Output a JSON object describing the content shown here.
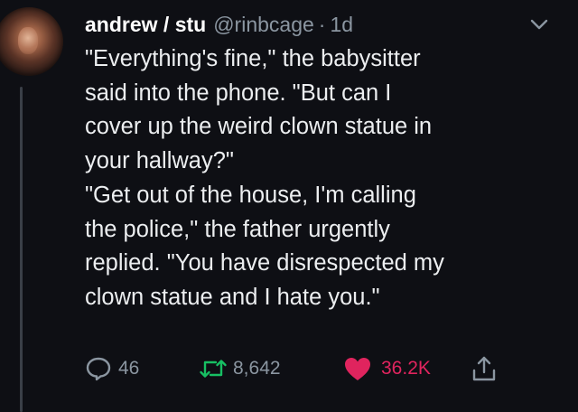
{
  "tweet": {
    "author_name": "andrew / stu",
    "handle": "@rinbcage",
    "separator": "·",
    "time": "1d",
    "lines": [
      "\"Everything's fine,\" the babysitter",
      "said into the phone. \"But can I",
      "cover up the weird clown statue in",
      "your hallway?\"",
      "\"Get out of the house, I'm calling",
      "the police,\" the father urgently",
      "replied. \"You have disrespected my",
      "clown statue and I hate you.\""
    ]
  },
  "actions": {
    "replies": "46",
    "retweets": "8,642",
    "likes": "36.2K"
  },
  "icons": {
    "reply": "reply-icon",
    "retweet": "retweet-icon",
    "like": "heart-icon",
    "share": "share-icon",
    "menu": "chevron-down-icon"
  },
  "colors": {
    "background": "#0e0f14",
    "text": "#eceef0",
    "secondary": "#8b96a1",
    "retweet": "#17bf63",
    "like": "#e0245e"
  }
}
